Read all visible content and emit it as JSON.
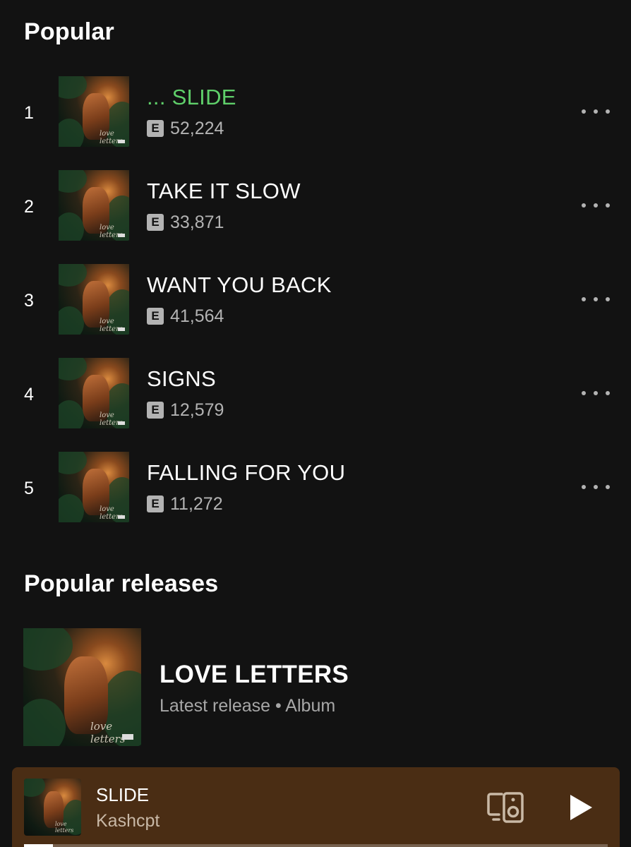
{
  "popular": {
    "title": "Popular",
    "tracks": [
      {
        "index": "1",
        "title": "... SLIDE",
        "plays": "52,224",
        "explicit": "E",
        "playing": true
      },
      {
        "index": "2",
        "title": "TAKE IT SLOW",
        "plays": "33,871",
        "explicit": "E",
        "playing": false
      },
      {
        "index": "3",
        "title": "WANT YOU BACK",
        "plays": "41,564",
        "explicit": "E",
        "playing": false
      },
      {
        "index": "4",
        "title": "SIGNS",
        "plays": "12,579",
        "explicit": "E",
        "playing": false
      },
      {
        "index": "5",
        "title": "FALLING FOR YOU",
        "plays": "11,272",
        "explicit": "E",
        "playing": false
      }
    ],
    "more_icon": "more-options-icon"
  },
  "popular_releases": {
    "title": "Popular releases",
    "items": [
      {
        "title": "LOVE LETTERS",
        "subtitle": "Latest release • Album"
      }
    ]
  },
  "now_playing": {
    "title": "SLIDE",
    "artist": "Kashcpt",
    "device_icon": "connect-device-icon",
    "play_icon": "play-icon",
    "progress": 0.05
  },
  "colors": {
    "background": "#121212",
    "accent_green": "#5fcf6a",
    "mini_player_bg": "#4a2d14",
    "secondary_text": "#b3b3b3"
  }
}
